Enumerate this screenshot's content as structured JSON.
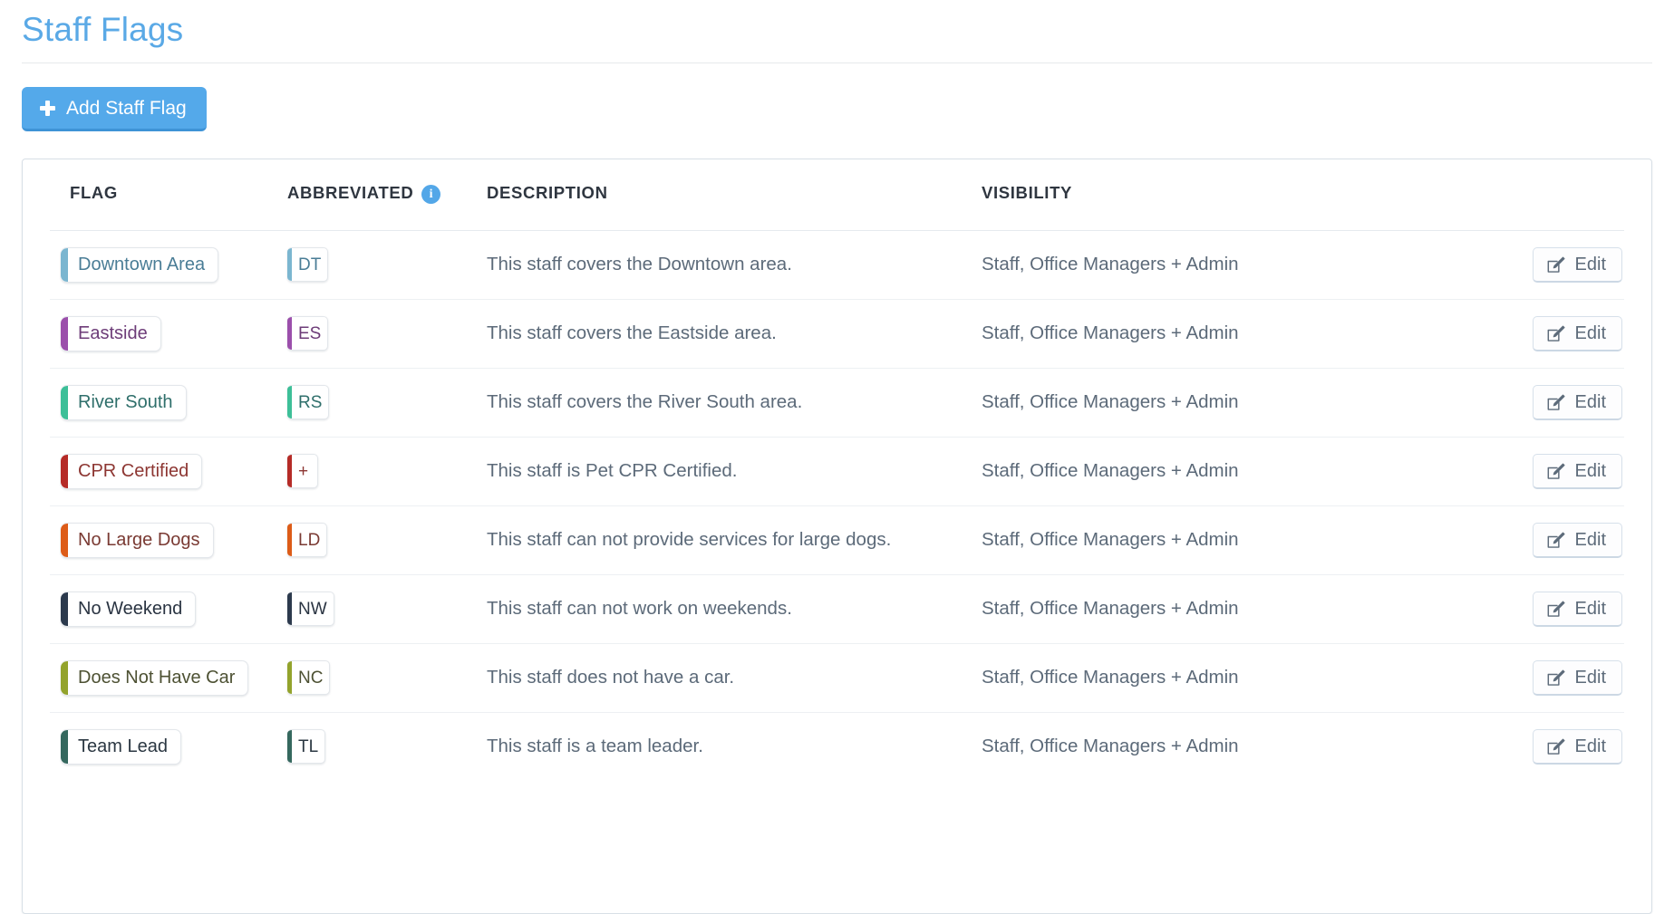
{
  "page": {
    "title": "Staff Flags"
  },
  "toolbar": {
    "add_label": "Add Staff Flag",
    "add_icon": "plus-icon",
    "accent_color": "#54a9ea"
  },
  "table": {
    "headers": {
      "flag": "FLAG",
      "abbreviated": "ABBREVIATED",
      "abbreviated_info_icon": "info-icon",
      "description": "DESCRIPTION",
      "visibility": "VISIBILITY"
    },
    "row_action_label": "Edit",
    "row_action_icon": "pencil-square-icon",
    "rows": [
      {
        "flag": "Downtown Area",
        "abbr": "DT",
        "description": "This staff covers the Downtown area.",
        "visibility": "Staff, Office Managers + Admin",
        "color": "#7bb6d0",
        "text_color": "#4a7d96",
        "edit": "Edit"
      },
      {
        "flag": "Eastside",
        "abbr": "ES",
        "description": "This staff covers the Eastside area.",
        "visibility": "Staff, Office Managers + Admin",
        "color": "#9b4fab",
        "text_color": "#6d3c78",
        "edit": "Edit"
      },
      {
        "flag": "River South",
        "abbr": "RS",
        "description": "This staff covers the River South area.",
        "visibility": "Staff, Office Managers + Admin",
        "color": "#3dbf98",
        "text_color": "#2f6f6b",
        "edit": "Edit"
      },
      {
        "flag": "CPR Certified",
        "abbr": "+",
        "description": "This staff is Pet CPR Certified.",
        "visibility": "Staff, Office Managers + Admin",
        "color": "#b52b27",
        "text_color": "#8d3632",
        "edit": "Edit"
      },
      {
        "flag": "No Large Dogs",
        "abbr": "LD",
        "description": "This staff can not provide services for large dogs.",
        "visibility": "Staff, Office Managers + Admin",
        "color": "#dd5c18",
        "text_color": "#7a3a33",
        "edit": "Edit"
      },
      {
        "flag": "No Weekend",
        "abbr": "NW",
        "description": "This staff can not work on weekends.",
        "visibility": "Staff, Office Managers + Admin",
        "color": "#2c3a4d",
        "text_color": "#2a3442",
        "edit": "Edit"
      },
      {
        "flag": "Does Not Have Car",
        "abbr": "NC",
        "description": "This staff does not have a car.",
        "visibility": "Staff, Office Managers + Admin",
        "color": "#93a32c",
        "text_color": "#4d5133",
        "edit": "Edit"
      },
      {
        "flag": "Team Lead",
        "abbr": "TL",
        "description": "This staff is a team leader.",
        "visibility": "Staff, Office Managers + Admin",
        "color": "#35685e",
        "text_color": "#2b3742",
        "edit": "Edit"
      }
    ]
  }
}
